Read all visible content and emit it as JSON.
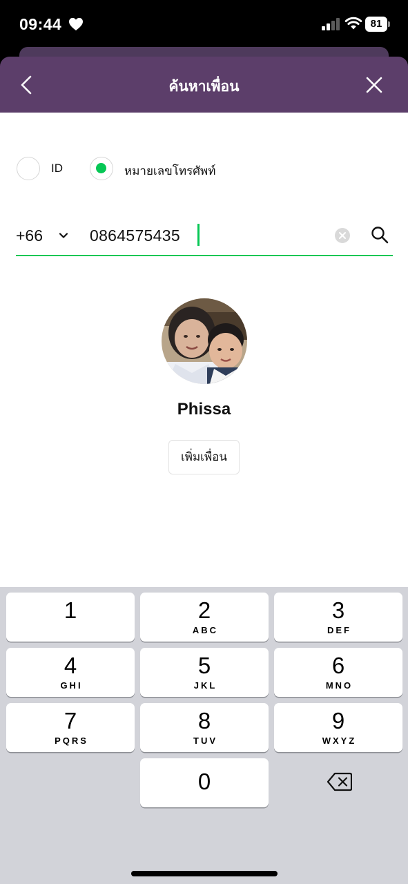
{
  "status_bar": {
    "time": "09:44",
    "battery": "81",
    "icons": [
      "heart-icon",
      "signal-icon",
      "wifi-icon",
      "battery-icon"
    ]
  },
  "header": {
    "title": "ค้นหาเพื่อน",
    "back_icon": "chevron-left-icon",
    "close_icon": "close-icon",
    "color": "#5c3e6a"
  },
  "search_type": {
    "options": [
      {
        "label": "ID",
        "selected": false
      },
      {
        "label": "หมายเลขโทรศัพท์",
        "selected": true
      }
    ]
  },
  "phone_search": {
    "country_code": "+66",
    "value": "0864575435",
    "accent_color": "#06c755"
  },
  "result": {
    "name": "Phissa",
    "add_button_label": "เพิ่มเพื่อน"
  },
  "keypad": {
    "keys": [
      {
        "digit": "1",
        "letters": ""
      },
      {
        "digit": "2",
        "letters": "ABC"
      },
      {
        "digit": "3",
        "letters": "DEF"
      },
      {
        "digit": "4",
        "letters": "GHI"
      },
      {
        "digit": "5",
        "letters": "JKL"
      },
      {
        "digit": "6",
        "letters": "MNO"
      },
      {
        "digit": "7",
        "letters": "PQRS"
      },
      {
        "digit": "8",
        "letters": "TUV"
      },
      {
        "digit": "9",
        "letters": "WXYZ"
      },
      {
        "digit": "0",
        "letters": ""
      }
    ],
    "backspace_icon": "backspace-icon"
  }
}
